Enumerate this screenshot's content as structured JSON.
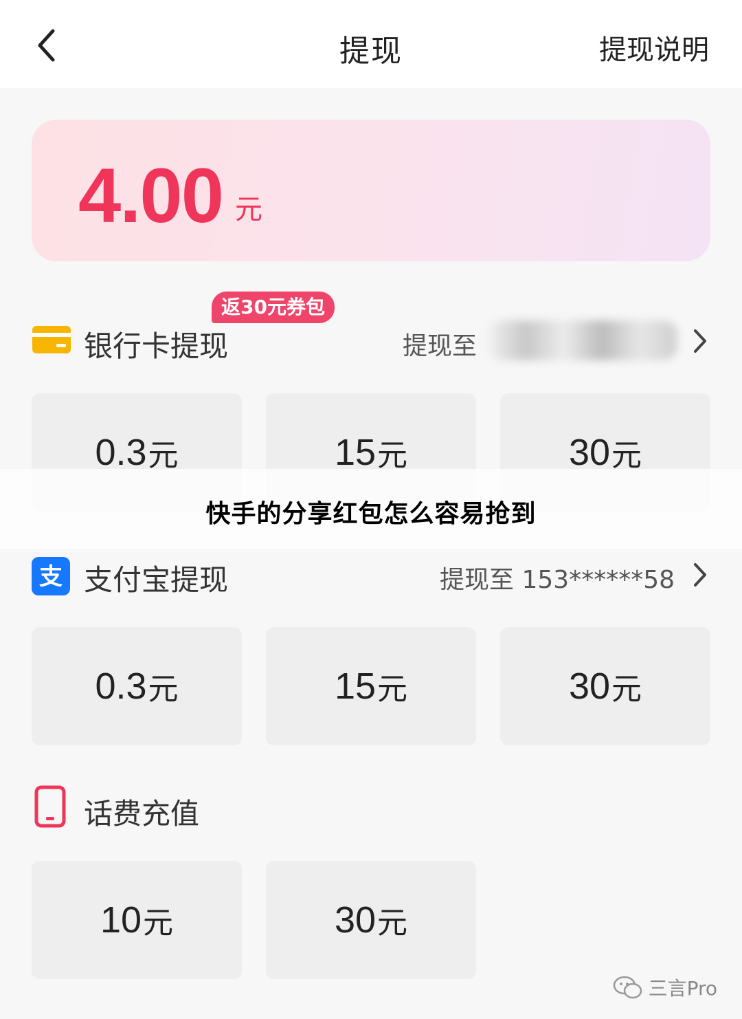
{
  "header": {
    "title": "提现",
    "right_label": "提现说明"
  },
  "balance": {
    "amount": "4.00",
    "unit": "元"
  },
  "bank_section": {
    "title": "银行卡提现",
    "badge": "返30元券包",
    "right_text": "提现至",
    "options": [
      {
        "num": "0.3",
        "unit": "元"
      },
      {
        "num": "15",
        "unit": "元"
      },
      {
        "num": "30",
        "unit": "元"
      }
    ]
  },
  "alipay_section": {
    "title": "支付宝提现",
    "right_text": "提现至 153******58",
    "options": [
      {
        "num": "0.3",
        "unit": "元"
      },
      {
        "num": "15",
        "unit": "元"
      },
      {
        "num": "30",
        "unit": "元"
      }
    ]
  },
  "phone_section": {
    "title": "话费充值",
    "options": [
      {
        "num": "10",
        "unit": "元"
      },
      {
        "num": "30",
        "unit": "元"
      }
    ]
  },
  "overlay_caption": "快手的分享红包怎么容易抢到",
  "watermark": "三言Pro",
  "colors": {
    "accent": "#f0355a",
    "bank_icon": "#f7b500",
    "alipay_icon": "#1677ff",
    "phone_icon": "#f0355a"
  },
  "icons": {
    "back": "chevron-left-icon",
    "bank": "bank-card-icon",
    "alipay": "alipay-icon",
    "phone": "mobile-phone-icon",
    "arrow": "chevron-right-icon",
    "watermark": "wechat-icon"
  }
}
